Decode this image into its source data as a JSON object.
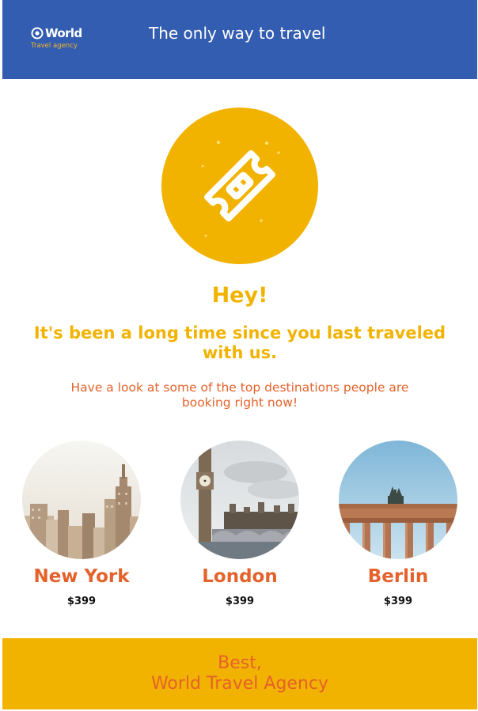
{
  "header": {
    "logo_word": "World",
    "logo_subtitle": "Travel agency",
    "title": "The only way to travel"
  },
  "hero": {
    "icon": "ticket-icon",
    "greeting": "Hey!",
    "subtitle": "It's been a long time since you last traveled with us.",
    "intro": "Have a look at some of the top destinations people are booking right now!"
  },
  "destinations": [
    {
      "name": "New York",
      "price": "$399",
      "image": "new-york-skyline"
    },
    {
      "name": "London",
      "price": "$399",
      "image": "big-ben-westminster"
    },
    {
      "name": "Berlin",
      "price": "$399",
      "image": "brandenburg-gate"
    }
  ],
  "footer": {
    "line1": "Best,",
    "line2": "World Travel Agency"
  },
  "colors": {
    "header_bg": "#325db0",
    "accent_yellow": "#f2b300",
    "accent_orange": "#e4622b"
  }
}
